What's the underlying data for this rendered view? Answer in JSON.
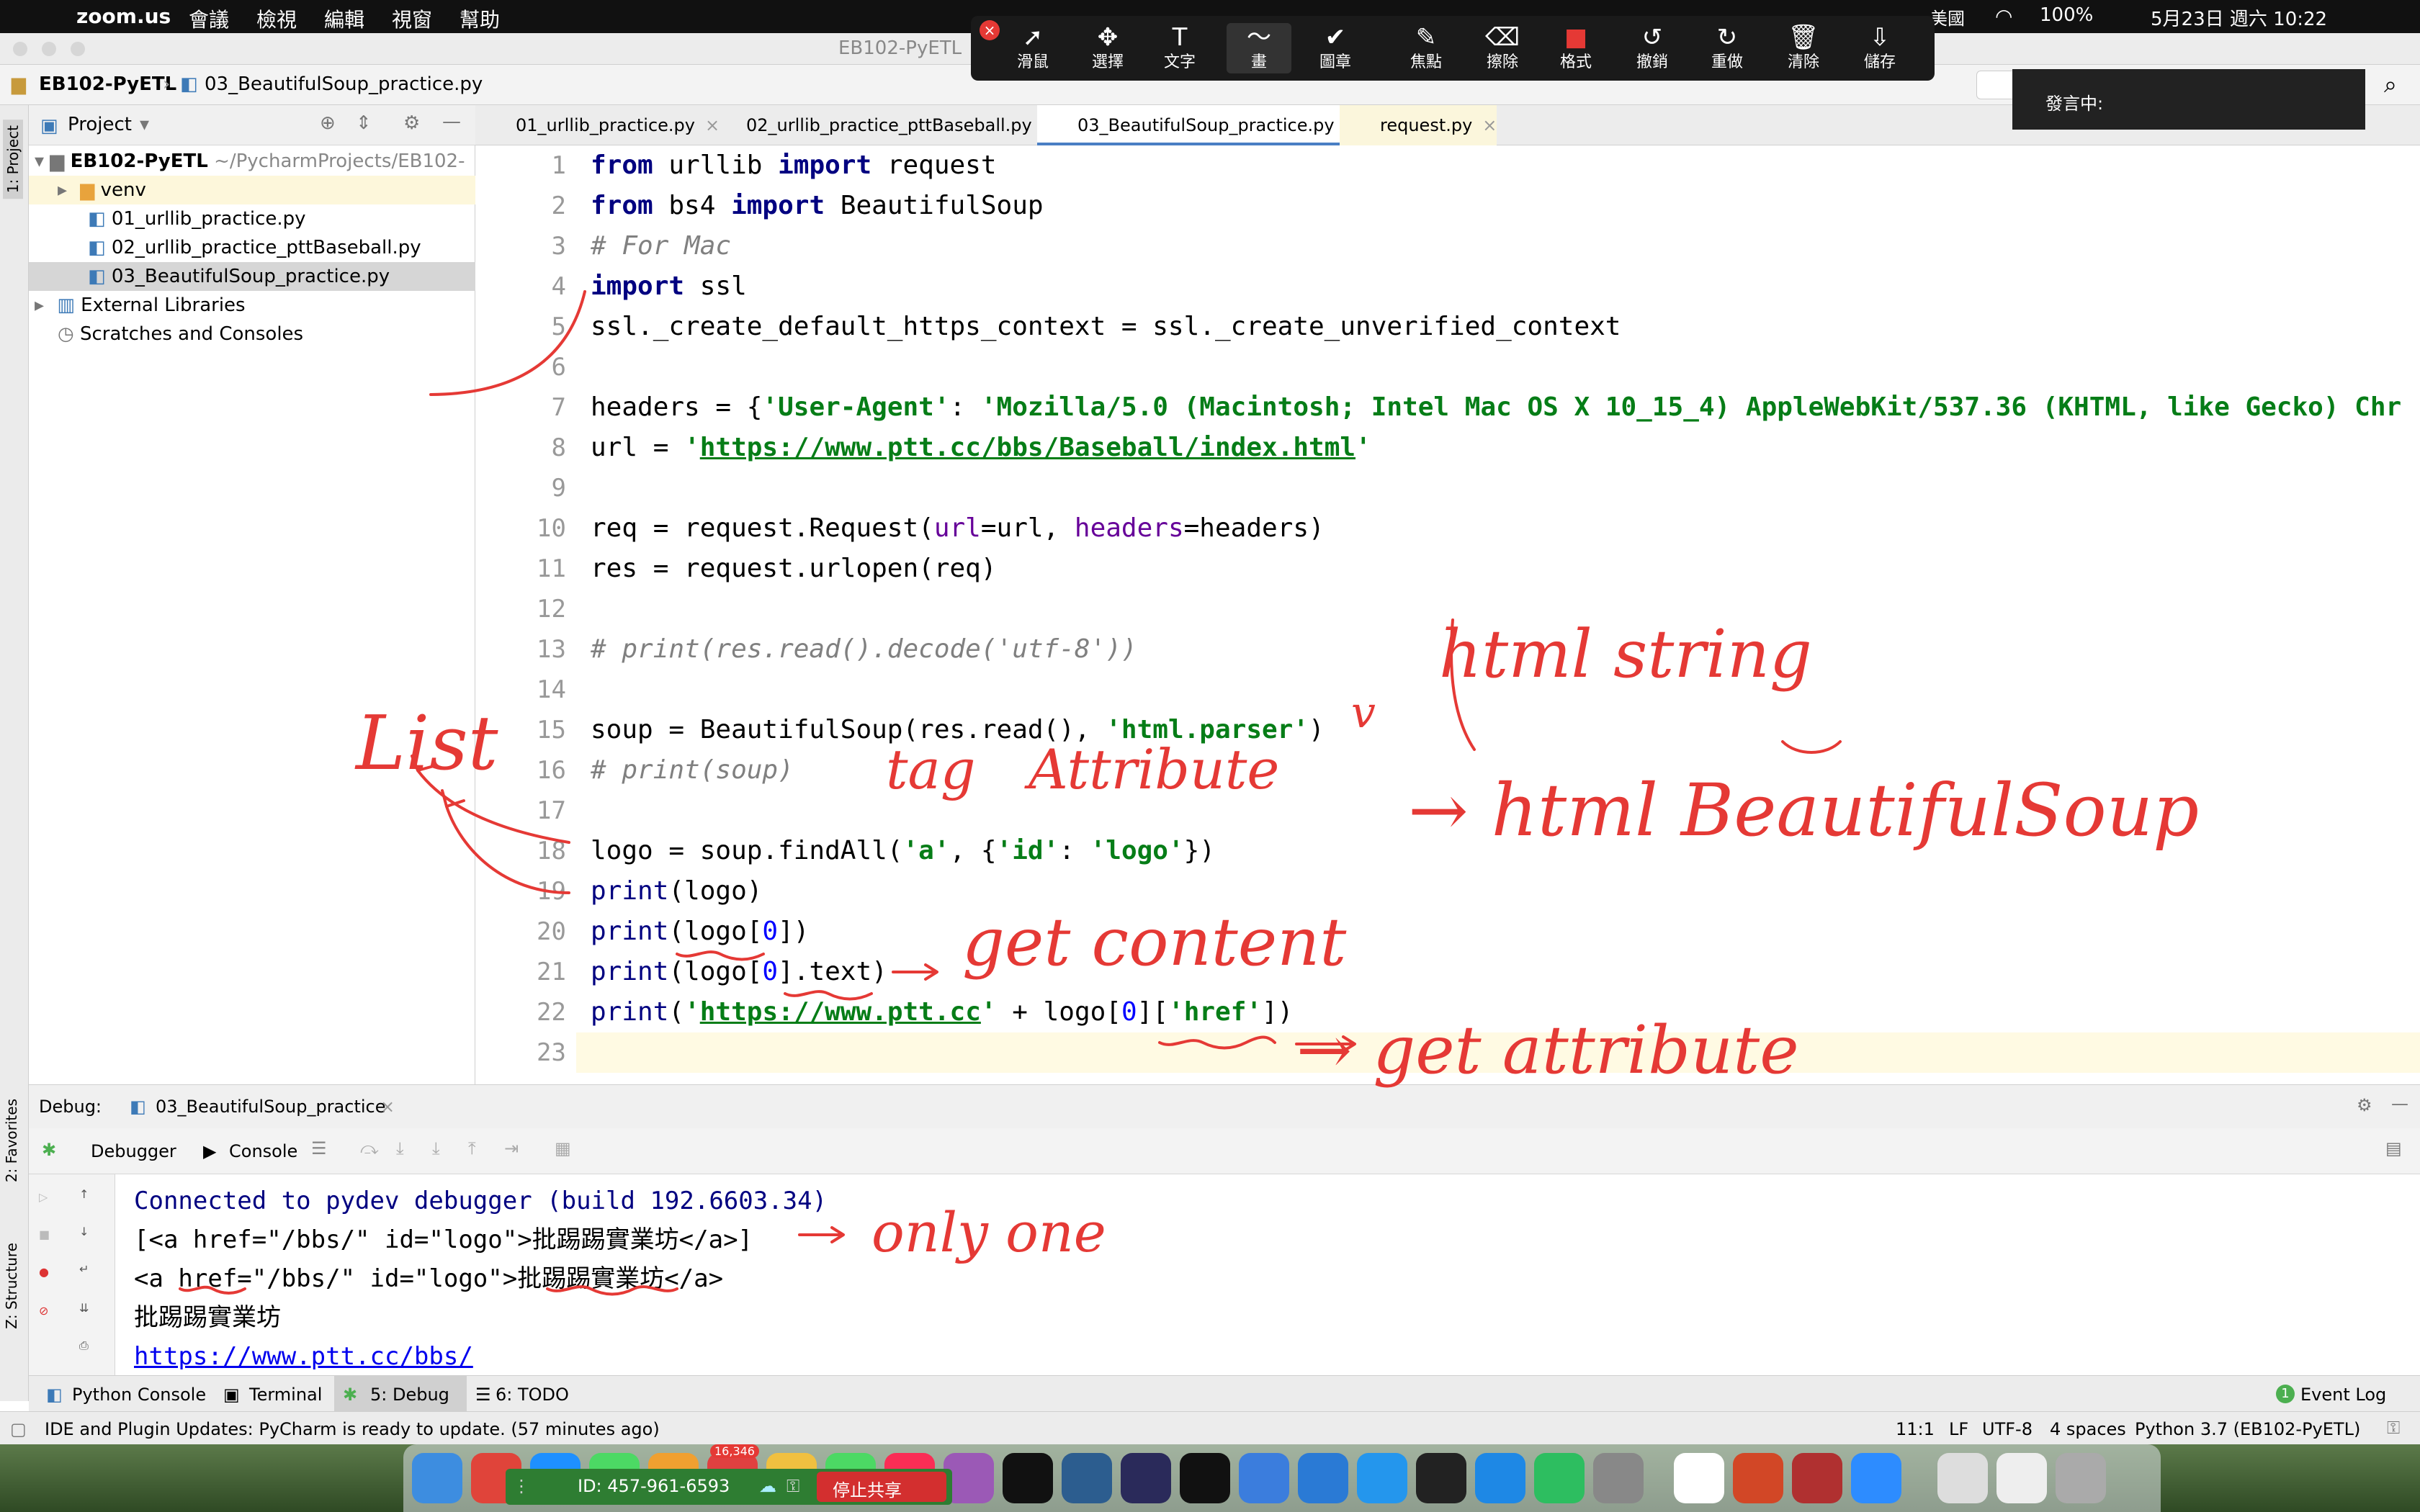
{
  "menubar": {
    "app": "zoom.us",
    "items": [
      "會議",
      "檢視",
      "編輯",
      "視窗",
      "幫助"
    ],
    "input_source": "美國",
    "battery": "100%",
    "datetime": "5月23日 週六 10:22"
  },
  "annotation_toolbar": {
    "tools": [
      {
        "label": "滑鼠",
        "icon": "mouse-pointer-icon"
      },
      {
        "label": "選擇",
        "icon": "select-move-icon"
      },
      {
        "label": "文字",
        "icon": "text-icon"
      },
      {
        "label": "畫",
        "icon": "draw-icon"
      },
      {
        "label": "圖章",
        "icon": "stamp-icon"
      },
      {
        "label": "焦點",
        "icon": "spotlight-icon"
      },
      {
        "label": "擦除",
        "icon": "eraser-icon"
      },
      {
        "label": "格式",
        "icon": "format-icon"
      },
      {
        "label": "撤銷",
        "icon": "undo-icon"
      },
      {
        "label": "重做",
        "icon": "redo-icon"
      },
      {
        "label": "清除",
        "icon": "trash-icon"
      },
      {
        "label": "儲存",
        "icon": "save-icon"
      }
    ],
    "glyphs": [
      "➚",
      "✥",
      "T",
      "〜",
      "✔",
      "✎",
      "⌫",
      "■",
      "↺",
      "↻",
      "🗑",
      "⇩"
    ],
    "active": "畫",
    "accent": "#e53935"
  },
  "speaking": {
    "label": "發言中:"
  },
  "window": {
    "title": "EB102-PyETL"
  },
  "breadcrumb": {
    "project": "EB102-PyETL",
    "file": "03_BeautifulSoup_practice.py"
  },
  "left_strip": {
    "project_tab": "1: Project",
    "favorites_tab": "2: Favorites",
    "structure_tab": "Z: Structure"
  },
  "project_panel": {
    "title": "Project",
    "root_name": "EB102-PyETL",
    "root_path": "~/PycharmProjects/EB102-",
    "items": [
      "venv",
      "01_urllib_practice.py",
      "02_urllib_practice_pttBaseball.py",
      "03_BeautifulSoup_practice.py",
      "External Libraries",
      "Scratches and Consoles"
    ]
  },
  "editor_tabs": [
    "01_urllib_practice.py",
    "02_urllib_practice_pttBaseball.py",
    "03_BeautifulSoup_practice.py",
    "request.py"
  ],
  "line_numbers": [
    "1",
    "2",
    "3",
    "4",
    "5",
    "6",
    "7",
    "8",
    "9",
    "10",
    "11",
    "12",
    "13",
    "14",
    "15",
    "16",
    "17",
    "18",
    "19",
    "20",
    "21",
    "22",
    "23"
  ],
  "code": {
    "l1": {
      "a": "from",
      "b": " urllib ",
      "c": "import",
      "d": " request"
    },
    "l2": {
      "a": "from",
      "b": " bs4 ",
      "c": "import",
      "d": " BeautifulSoup"
    },
    "l3": "# For Mac",
    "l4": {
      "a": "import",
      "b": " ssl"
    },
    "l5": "ssl._create_default_https_context = ssl._create_unverified_context",
    "l7": {
      "a": "headers = {",
      "b": "'User-Agent'",
      "c": ": ",
      "d": "'Mozilla/5.0 (Macintosh; Intel Mac OS X 10_15_4) AppleWebKit/537.36 (KHTML, like Gecko) Chr"
    },
    "l8": {
      "a": "url = ",
      "b": "'",
      "c": "https://www.ptt.cc/bbs/Baseball/index.html",
      "d": "'"
    },
    "l10": {
      "a": "req = request.Request(",
      "b": "url",
      "c": "=url, ",
      "d": "headers",
      "e": "=headers)"
    },
    "l11": "res = request.urlopen(req)",
    "l13": "# print(res.read().decode('utf-8'))",
    "l15": {
      "a": "soup = BeautifulSoup(res.read(), ",
      "b": "'html.parser'",
      "c": ")"
    },
    "l16": "# print(soup)",
    "l18": {
      "a": "logo = soup.findAll(",
      "b": "'a'",
      "c": ", {",
      "d": "'id'",
      "e": ": ",
      "f": "'logo'",
      "g": "})"
    },
    "l19": {
      "a": "print",
      "b": "(logo)"
    },
    "l20": {
      "a": "print",
      "b": "(logo[",
      "c": "0",
      "d": "])"
    },
    "l21": {
      "a": "print",
      "b": "(logo[",
      "c": "0",
      "d": "].text)"
    },
    "l22": {
      "a": "print",
      "b": "(",
      "c": "'",
      "d": "https://www.ptt.cc",
      "e": "'",
      "f": " + logo[",
      "g": "0",
      "h": "][",
      "i": "'href'",
      "j": "])"
    }
  },
  "debug": {
    "label": "Debug:",
    "config": "03_BeautifulSoup_practice",
    "tab_debugger": "Debugger",
    "tab_console": "Console"
  },
  "console": [
    "Connected to pydev debugger (build 192.6603.34)",
    "[<a href=\"/bbs/\" id=\"logo\">批踢踢實業坊</a>]",
    "<a href=\"/bbs/\" id=\"logo\">批踢踢實業坊</a>",
    "批踢踢實業坊",
    "https://www.ptt.cc/bbs/"
  ],
  "bottom_tabs": {
    "python_console": "Python Console",
    "terminal": "Terminal",
    "debug": "5: Debug",
    "todo": "6: TODO",
    "event_log": "Event Log",
    "event_count": "1"
  },
  "status": {
    "message": "IDE and Plugin Updates: PyCharm is ready to update. (57 minutes ago)",
    "position": "11:1",
    "line_sep": "LF",
    "encoding": "UTF-8",
    "indent": "4 spaces",
    "interpreter": "Python 3.7 (EB102-PyETL)"
  },
  "share": {
    "meeting_id": "ID: 457-961-6593",
    "stop": "停止共享",
    "badge": "16,346"
  },
  "annotations": {
    "list": "List",
    "html_string": "html string",
    "tag": "tag",
    "attribute": "Attribute",
    "html_bs": "→ html BeautifulSoup",
    "get_content": "get content",
    "get_attribute": "→ get attribute",
    "only_one": "only one",
    "check": "v"
  }
}
